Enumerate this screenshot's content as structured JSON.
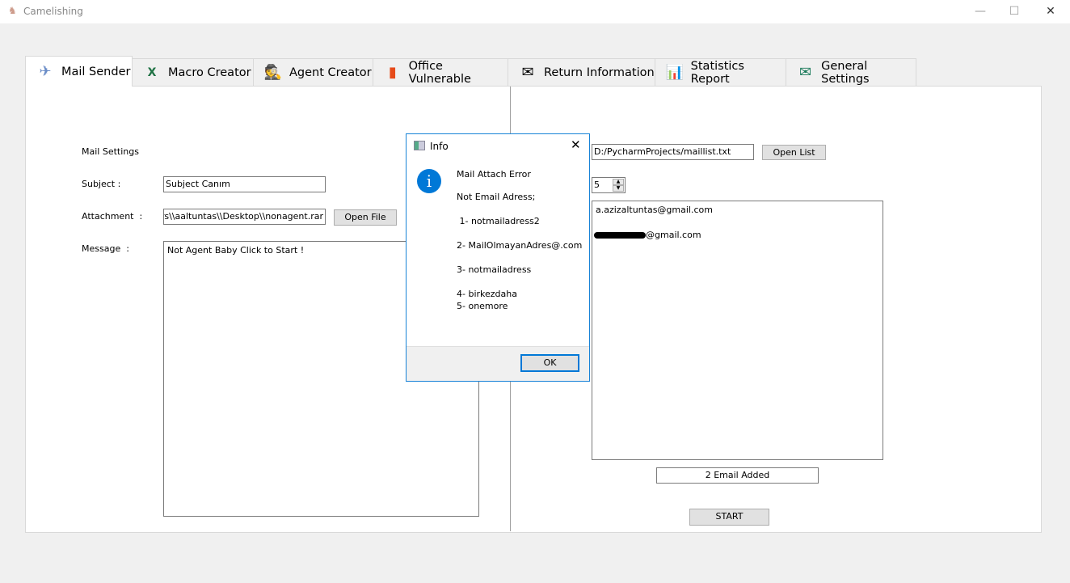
{
  "window": {
    "title": "Camelishing"
  },
  "tabs": [
    {
      "label": "Mail Sender",
      "icon": "paper-plane-icon"
    },
    {
      "label": "Macro Creator",
      "icon": "excel-icon"
    },
    {
      "label": "Agent Creator",
      "icon": "spy-icon"
    },
    {
      "label": "Office Vulnerable",
      "icon": "office-icon"
    },
    {
      "label": "Return Information",
      "icon": "envelope-search-icon"
    },
    {
      "label": "Statistics Report",
      "icon": "presentation-chart-icon"
    },
    {
      "label": "General Settings",
      "icon": "mail-settings-icon"
    }
  ],
  "left": {
    "section_title": "Mail Settings",
    "subject_label": "Subject :",
    "subject_value": "Subject Canım",
    "attachment_label": "Attachment  :",
    "attachment_value": "Jsers\\\\aaltuntas\\\\Desktop\\\\nonagent.rar",
    "open_file": "Open File",
    "message_label": "Message  :",
    "message_value": "Not Agent Baby Click to Start !"
  },
  "right": {
    "list_path": "D:/PycharmProjects/maillist.txt",
    "open_list": "Open List",
    "spin_value": "5",
    "emails": [
      "a.azizaltuntas@gmail.com",
      "@gmail.com"
    ],
    "status": "2 Email Added",
    "start": "START"
  },
  "dialog": {
    "title": "Info",
    "lines": [
      "Mail Attach Error",
      "Not Email Adress;",
      " 1- notmailadress2",
      "2- MailOlmayanAdres@.com",
      "3- notmailadress",
      "4- birkezdaha",
      "5- onemore"
    ],
    "ok": "OK",
    "accent": "#0078d7"
  }
}
